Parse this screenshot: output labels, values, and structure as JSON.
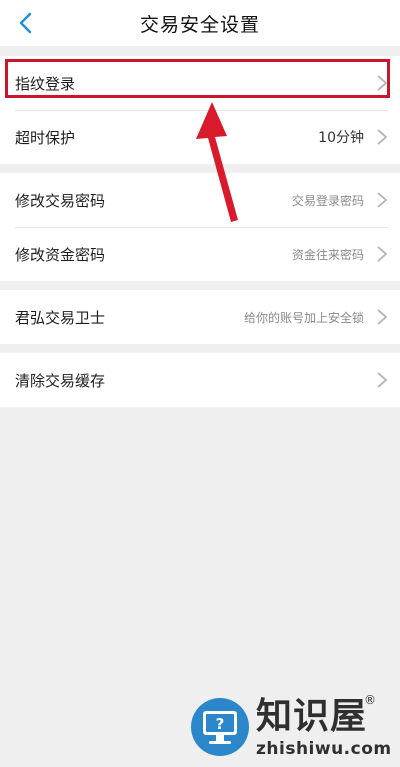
{
  "header": {
    "title": "交易安全设置",
    "back_icon": "chevron-left-icon"
  },
  "groups": [
    {
      "items": [
        {
          "label": "指纹登录",
          "value": ""
        },
        {
          "label": "超时保护",
          "value": "10分钟"
        }
      ]
    },
    {
      "items": [
        {
          "label": "修改交易密码",
          "value": "交易登录密码"
        },
        {
          "label": "修改资金密码",
          "value": "资金往来密码"
        }
      ]
    },
    {
      "items": [
        {
          "label": "君弘交易卫士",
          "value": "给你的账号加上安全锁"
        }
      ]
    },
    {
      "items": [
        {
          "label": "清除交易缓存",
          "value": ""
        }
      ]
    }
  ],
  "annotation": {
    "highlight_color": "#c8162c",
    "arrow_icon": "red-arrow-icon"
  },
  "watermark": {
    "title": "知识屋",
    "registered": "®",
    "domain": "zhishiwu.com"
  },
  "colors": {
    "accent": "#1a8fe0",
    "background": "#efefef",
    "chevron": "#b5b5b5"
  }
}
